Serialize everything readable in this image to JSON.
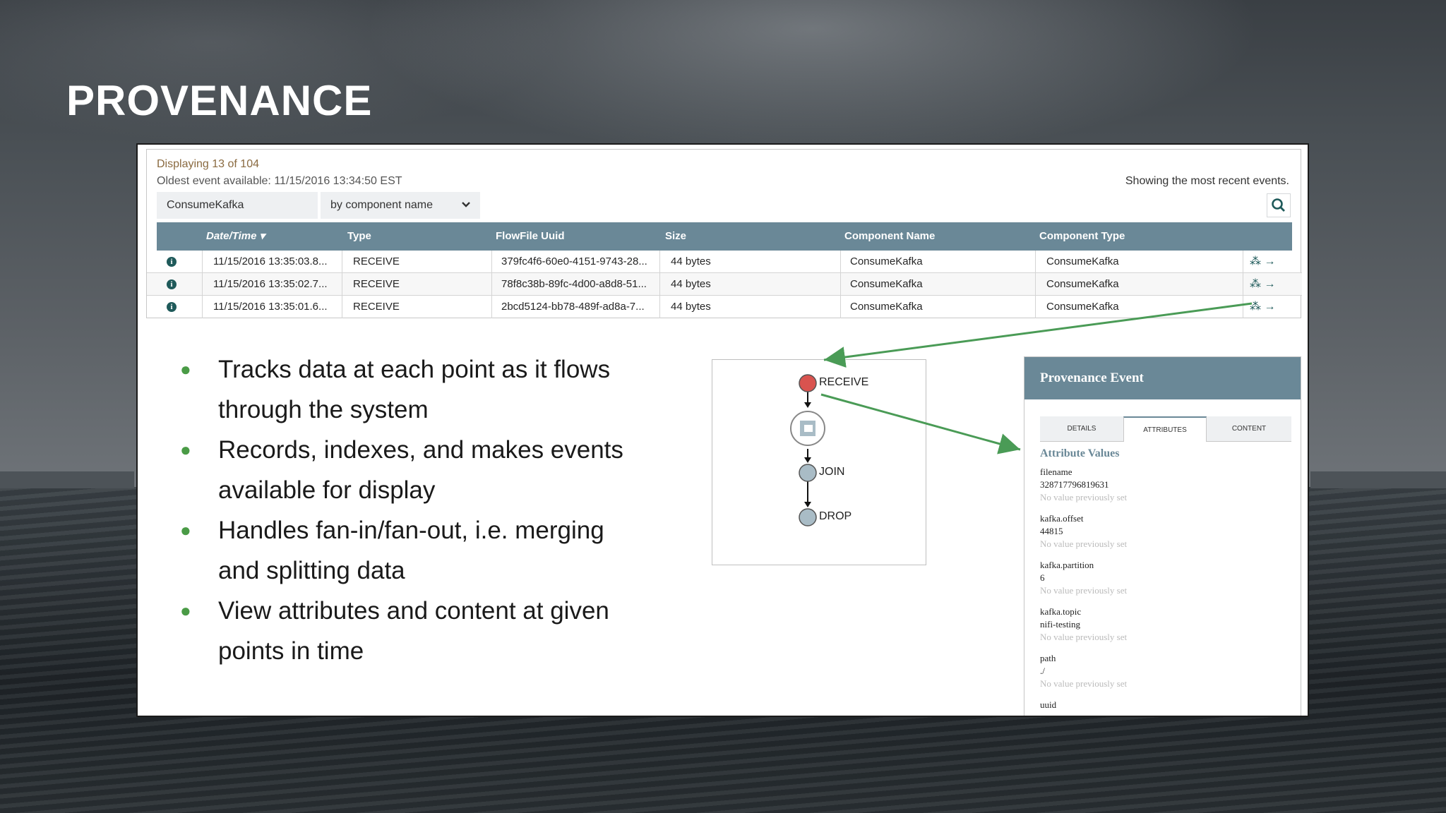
{
  "slide_title": "PROVENANCE",
  "provenance_table": {
    "displaying": "Displaying 13 of 104",
    "oldest_label": "Oldest event available:",
    "oldest_value": "11/15/2016 13:34:50 EST",
    "recent_text": "Showing the most recent events.",
    "filter_value": "ConsumeKafka",
    "filter_by": "by component name",
    "columns": [
      "Date/Time",
      "Type",
      "FlowFile Uuid",
      "Size",
      "Component Name",
      "Component Type"
    ],
    "rows": [
      {
        "datetime": "11/15/2016 13:35:03.8...",
        "type": "RECEIVE",
        "uuid": "379fc4f6-60e0-4151-9743-28...",
        "size": "44 bytes",
        "component_name": "ConsumeKafka",
        "component_type": "ConsumeKafka"
      },
      {
        "datetime": "11/15/2016 13:35:02.7...",
        "type": "RECEIVE",
        "uuid": "78f8c38b-89fc-4d00-a8d8-51...",
        "size": "44 bytes",
        "component_name": "ConsumeKafka",
        "component_type": "ConsumeKafka"
      },
      {
        "datetime": "11/15/2016 13:35:01.6...",
        "type": "RECEIVE",
        "uuid": "2bcd5124-bb78-489f-ad8a-7...",
        "size": "44 bytes",
        "component_name": "ConsumeKafka",
        "component_type": "ConsumeKafka"
      }
    ]
  },
  "bullets": [
    {
      "line1": "Tracks data at each point as it flows",
      "line2": "through the system"
    },
    {
      "line1": "Records, indexes, and makes events",
      "line2": "available for display"
    },
    {
      "line1": "Handles fan-in/fan-out, i.e. merging",
      "line2": "and splitting data"
    },
    {
      "line1": "View attributes and content at given",
      "line2": "points in time"
    }
  ],
  "lineage": {
    "nodes": [
      "RECEIVE",
      "JOIN",
      "DROP"
    ]
  },
  "provenance_event": {
    "title": "Provenance Event",
    "tabs": [
      "DETAILS",
      "ATTRIBUTES",
      "CONTENT"
    ],
    "section_title": "Attribute Values",
    "no_value_text": "No value previously set",
    "attributes": [
      {
        "key": "filename",
        "value": "328717796819631"
      },
      {
        "key": "kafka.offset",
        "value": "44815"
      },
      {
        "key": "kafka.partition",
        "value": "6"
      },
      {
        "key": "kafka.topic",
        "value": "nifi-testing"
      },
      {
        "key": "path",
        "value": "./"
      },
      {
        "key": "uuid",
        "value": ""
      }
    ]
  },
  "colors": {
    "table_header": "#6a8897",
    "bullet_dot": "#4a9b46",
    "arrow": "#4a9b56",
    "receive_node": "#d9534f",
    "other_node": "#a9bcc6"
  }
}
